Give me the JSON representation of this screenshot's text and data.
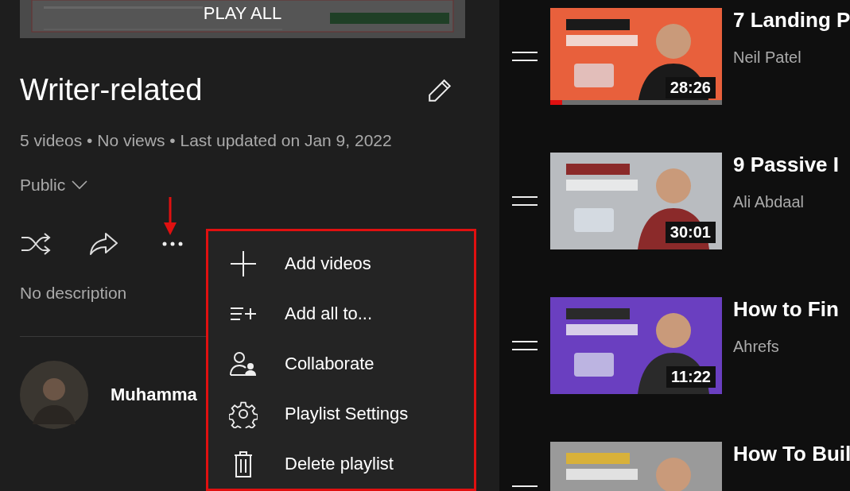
{
  "playlist": {
    "play_all": "PLAY ALL",
    "title": "Writer-related",
    "meta": "5 videos • No views • Last updated on Jan 9, 2022",
    "privacy": "Public",
    "description": "No description",
    "owner": "Muhamma"
  },
  "menu": {
    "items": [
      {
        "kind": "add",
        "label": "Add videos"
      },
      {
        "kind": "addall",
        "label": "Add all to..."
      },
      {
        "kind": "collab",
        "label": "Collaborate"
      },
      {
        "kind": "settings",
        "label": "Playlist Settings"
      },
      {
        "kind": "delete",
        "label": "Delete playlist"
      }
    ]
  },
  "videos": [
    {
      "title": "7 Landing P",
      "channel": "Neil Patel",
      "duration": "28:26",
      "level": 0.07
    },
    {
      "title": "9 Passive I",
      "channel": "Ali Abdaal",
      "duration": "30:01"
    },
    {
      "title": "How to Fin",
      "channel": "Ahrefs",
      "duration": "11:22"
    },
    {
      "title": "How To Buil"
    }
  ]
}
